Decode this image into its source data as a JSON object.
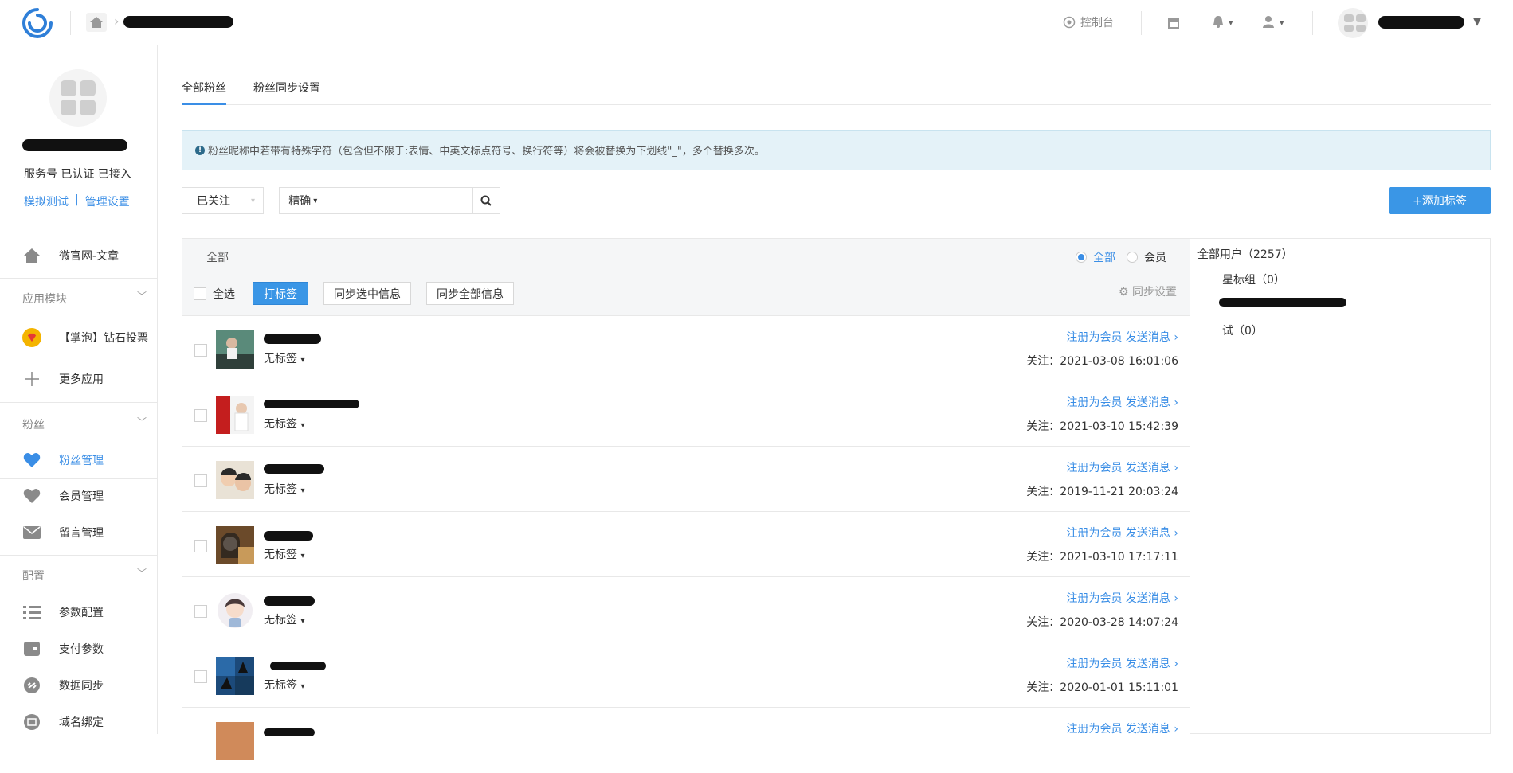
{
  "header": {
    "console_label": "控制台"
  },
  "sidebar": {
    "status_text": "服务号 已认证 已接入",
    "link_test": "模拟测试",
    "link_divider": "|",
    "link_manage": "管理设置",
    "items_top": [
      {
        "label": "微官网-文章"
      }
    ],
    "section_apps": "应用模块",
    "apps": [
      {
        "label": "【掌泡】钻石投票"
      },
      {
        "label": "更多应用"
      }
    ],
    "section_fans": "粉丝",
    "fans": [
      {
        "label": "粉丝管理"
      },
      {
        "label": "会员管理"
      },
      {
        "label": "留言管理"
      }
    ],
    "section_config": "配置",
    "config": [
      {
        "label": "参数配置"
      },
      {
        "label": "支付参数"
      },
      {
        "label": "数据同步"
      },
      {
        "label": "域名绑定"
      }
    ]
  },
  "main": {
    "tabs": [
      {
        "label": "全部粉丝"
      },
      {
        "label": "粉丝同步设置"
      }
    ],
    "notice": "粉丝昵称中若带有特殊字符（包含但不限于:表情、中英文标点符号、换行符等）将会被替换为下划线\"_\"，多个替换多次。",
    "filter_status": "已关注",
    "search_mode": "精确",
    "search_value": "",
    "add_tag_label": "+添加标签"
  },
  "list": {
    "head_all": "全部",
    "radio_all": "全部",
    "radio_member": "会员",
    "select_all": "全选",
    "btn_tag": "打标签",
    "btn_sync_selected": "同步选中信息",
    "btn_sync_all": "同步全部信息",
    "sync_settings": "同步设置",
    "rows": [
      {
        "tag": "无标签",
        "actions": "注册为会员 发送消息",
        "follow": "关注：2021-03-08 16:01:06"
      },
      {
        "tag": "无标签",
        "actions": "注册为会员 发送消息",
        "follow": "关注：2021-03-10 15:42:39"
      },
      {
        "tag": "无标签",
        "actions": "注册为会员 发送消息",
        "follow": "关注：2019-11-21 20:03:24"
      },
      {
        "tag": "无标签",
        "actions": "注册为会员 发送消息",
        "follow": "关注：2021-03-10 17:17:11"
      },
      {
        "tag": "无标签",
        "actions": "注册为会员 发送消息",
        "follow": "关注：2020-03-28 14:07:24"
      },
      {
        "tag": "无标签",
        "actions": "注册为会员 发送消息",
        "follow": "关注：2020-01-01 15:11:01"
      },
      {
        "tag": "",
        "actions": "注册为会员 发送消息",
        "follow": ""
      }
    ]
  },
  "groups": {
    "all_users": "全部用户（2257）",
    "star_group": "星标组（0）",
    "test_group": "试（0）"
  },
  "colors": {
    "accent": "#3a8ee6",
    "notice_bg": "#e4f2f8"
  }
}
